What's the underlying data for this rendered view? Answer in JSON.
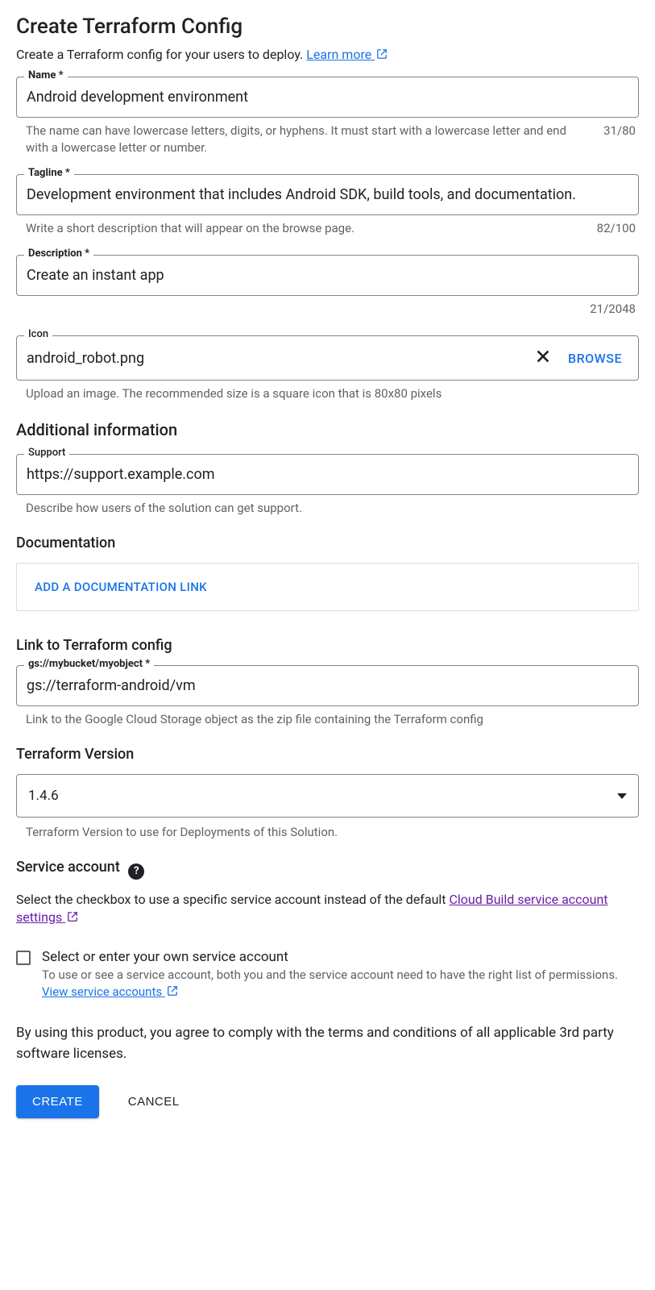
{
  "title": "Create Terraform Config",
  "intro_text": "Create a Terraform config for your users to deploy. ",
  "learn_more": "Learn more",
  "fields": {
    "name": {
      "label": "Name *",
      "value": "Android development environment",
      "helper": "The name can have lowercase letters, digits, or hyphens. It must start with a lowercase letter and end with a lowercase letter or number.",
      "counter": "31/80"
    },
    "tagline": {
      "label": "Tagline *",
      "value": "Development environment that includes Android SDK, build tools, and documentation.",
      "helper": "Write a short description that will appear on the browse page.",
      "counter": "82/100"
    },
    "description": {
      "label": "Description *",
      "value": "Create an instant app",
      "counter": "21/2048"
    },
    "icon": {
      "label": "Icon",
      "value": "android_robot.png",
      "browse": "BROWSE",
      "helper": "Upload an image. The recommended size is a square icon that is 80x80 pixels"
    },
    "support": {
      "label": "Support",
      "value": "https://support.example.com",
      "helper": "Describe how users of the solution can get support."
    },
    "gcs": {
      "label": "gs://mybucket/myobject *",
      "value": "gs://terraform-android/vm",
      "helper": "Link to the Google Cloud Storage object as the zip file containing the Terraform config"
    },
    "version": {
      "value": "1.4.6",
      "helper": "Terraform Version to use for Deployments of this Solution."
    }
  },
  "sections": {
    "additional": "Additional information",
    "documentation": "Documentation",
    "doc_link_btn": "ADD A DOCUMENTATION LINK",
    "link_tf": "Link to Terraform config",
    "tf_version": "Terraform Version",
    "svc_account": "Service account"
  },
  "service_account": {
    "desc_pre": "Select the checkbox to use a specific service account instead of the default ",
    "desc_link": "Cloud Build service account settings",
    "cb_title": "Select or enter your own service account",
    "cb_sub_pre": "To use or see a service account, both you and the service account need to have the right list of permissions. ",
    "cb_sub_link": "View service accounts"
  },
  "agree": "By using this product, you agree to comply with the terms and conditions of all applicable 3rd party software licenses.",
  "buttons": {
    "create": "CREATE",
    "cancel": "CANCEL"
  }
}
